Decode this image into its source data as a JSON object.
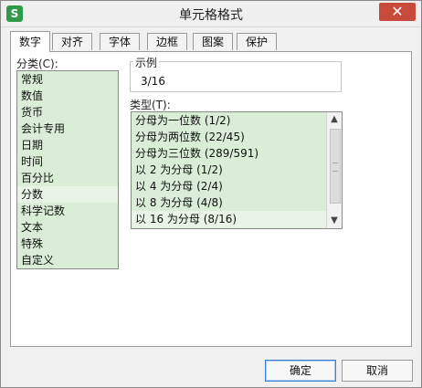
{
  "window": {
    "title": "单元格格式",
    "app_icon": "S",
    "close_glyph": "✕"
  },
  "tabs": [
    {
      "label": "数字"
    },
    {
      "label": "对齐"
    },
    {
      "label": "字体"
    },
    {
      "label": "边框"
    },
    {
      "label": "图案"
    },
    {
      "label": "保护"
    }
  ],
  "category": {
    "label": "分类(C):",
    "items": [
      "常规",
      "数值",
      "货币",
      "会计专用",
      "日期",
      "时间",
      "百分比",
      "分数",
      "科学记数",
      "文本",
      "特殊",
      "自定义"
    ],
    "selected_index": 7
  },
  "sample": {
    "label": "示例",
    "value": "3/16"
  },
  "type": {
    "label": "类型(T):",
    "items": [
      "分母为一位数 (1/2)",
      "分母为两位数 (22/45)",
      "分母为三位数 (289/591)",
      "以 2 为分母 (1/2)",
      "以 4 为分母 (2/4)",
      "以 8 为分母 (4/8)",
      "以 16 为分母 (8/16)"
    ],
    "selected_index": 6
  },
  "buttons": {
    "ok": "确定",
    "cancel": "取消"
  },
  "colors": {
    "list_bg": "#d9edd7",
    "selected_bg": "#e9f4e6",
    "close_red": "#c84a3a",
    "app_icon_green": "#2f9a47"
  }
}
